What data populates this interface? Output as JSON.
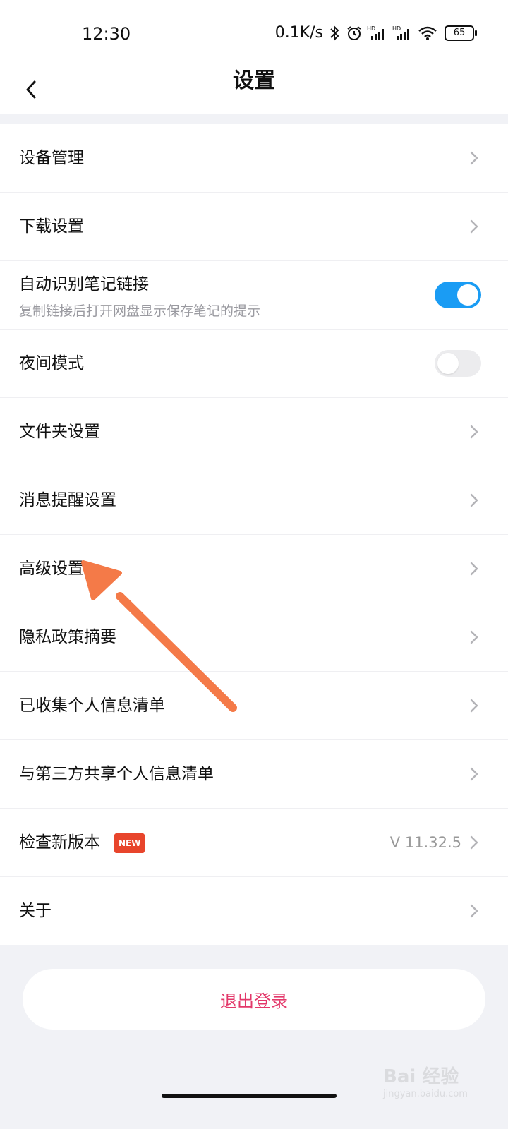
{
  "status_bar": {
    "time": "12:30",
    "net_speed": "0.1K/s",
    "battery": "65",
    "icons": [
      "bluetooth-icon",
      "alarm-icon",
      "signal-hd-icon",
      "signal-hd-icon",
      "wifi-icon",
      "battery-icon"
    ]
  },
  "header": {
    "title": "设置",
    "back_icon": "chevron-left-icon"
  },
  "settings": {
    "items": [
      {
        "label": "设备管理",
        "type": "link"
      },
      {
        "label": "下载设置",
        "type": "link"
      },
      {
        "label": "自动识别笔记链接",
        "sublabel": "复制链接后打开网盘显示保存笔记的提示",
        "type": "toggle",
        "on": true
      },
      {
        "label": "夜间模式",
        "type": "toggle",
        "on": false
      },
      {
        "label": "文件夹设置",
        "type": "link"
      },
      {
        "label": "消息提醒设置",
        "type": "link"
      },
      {
        "label": "高级设置",
        "type": "link"
      },
      {
        "label": "隐私政策摘要",
        "type": "link"
      },
      {
        "label": "已收集个人信息清单",
        "type": "link"
      },
      {
        "label": "与第三方共享个人信息清单",
        "type": "link"
      },
      {
        "label": "检查新版本",
        "badge": "NEW",
        "value": "V 11.32.5",
        "type": "link"
      },
      {
        "label": "关于",
        "type": "link"
      }
    ]
  },
  "logout": {
    "label": "退出登录"
  },
  "watermark": {
    "text": "Bai 经验",
    "sub": "jingyan.baidu.com"
  },
  "colors": {
    "accent": "#1a9cf4",
    "logout": "#e3386a",
    "badge": "#e8452c",
    "arrow": "#f47a48"
  }
}
